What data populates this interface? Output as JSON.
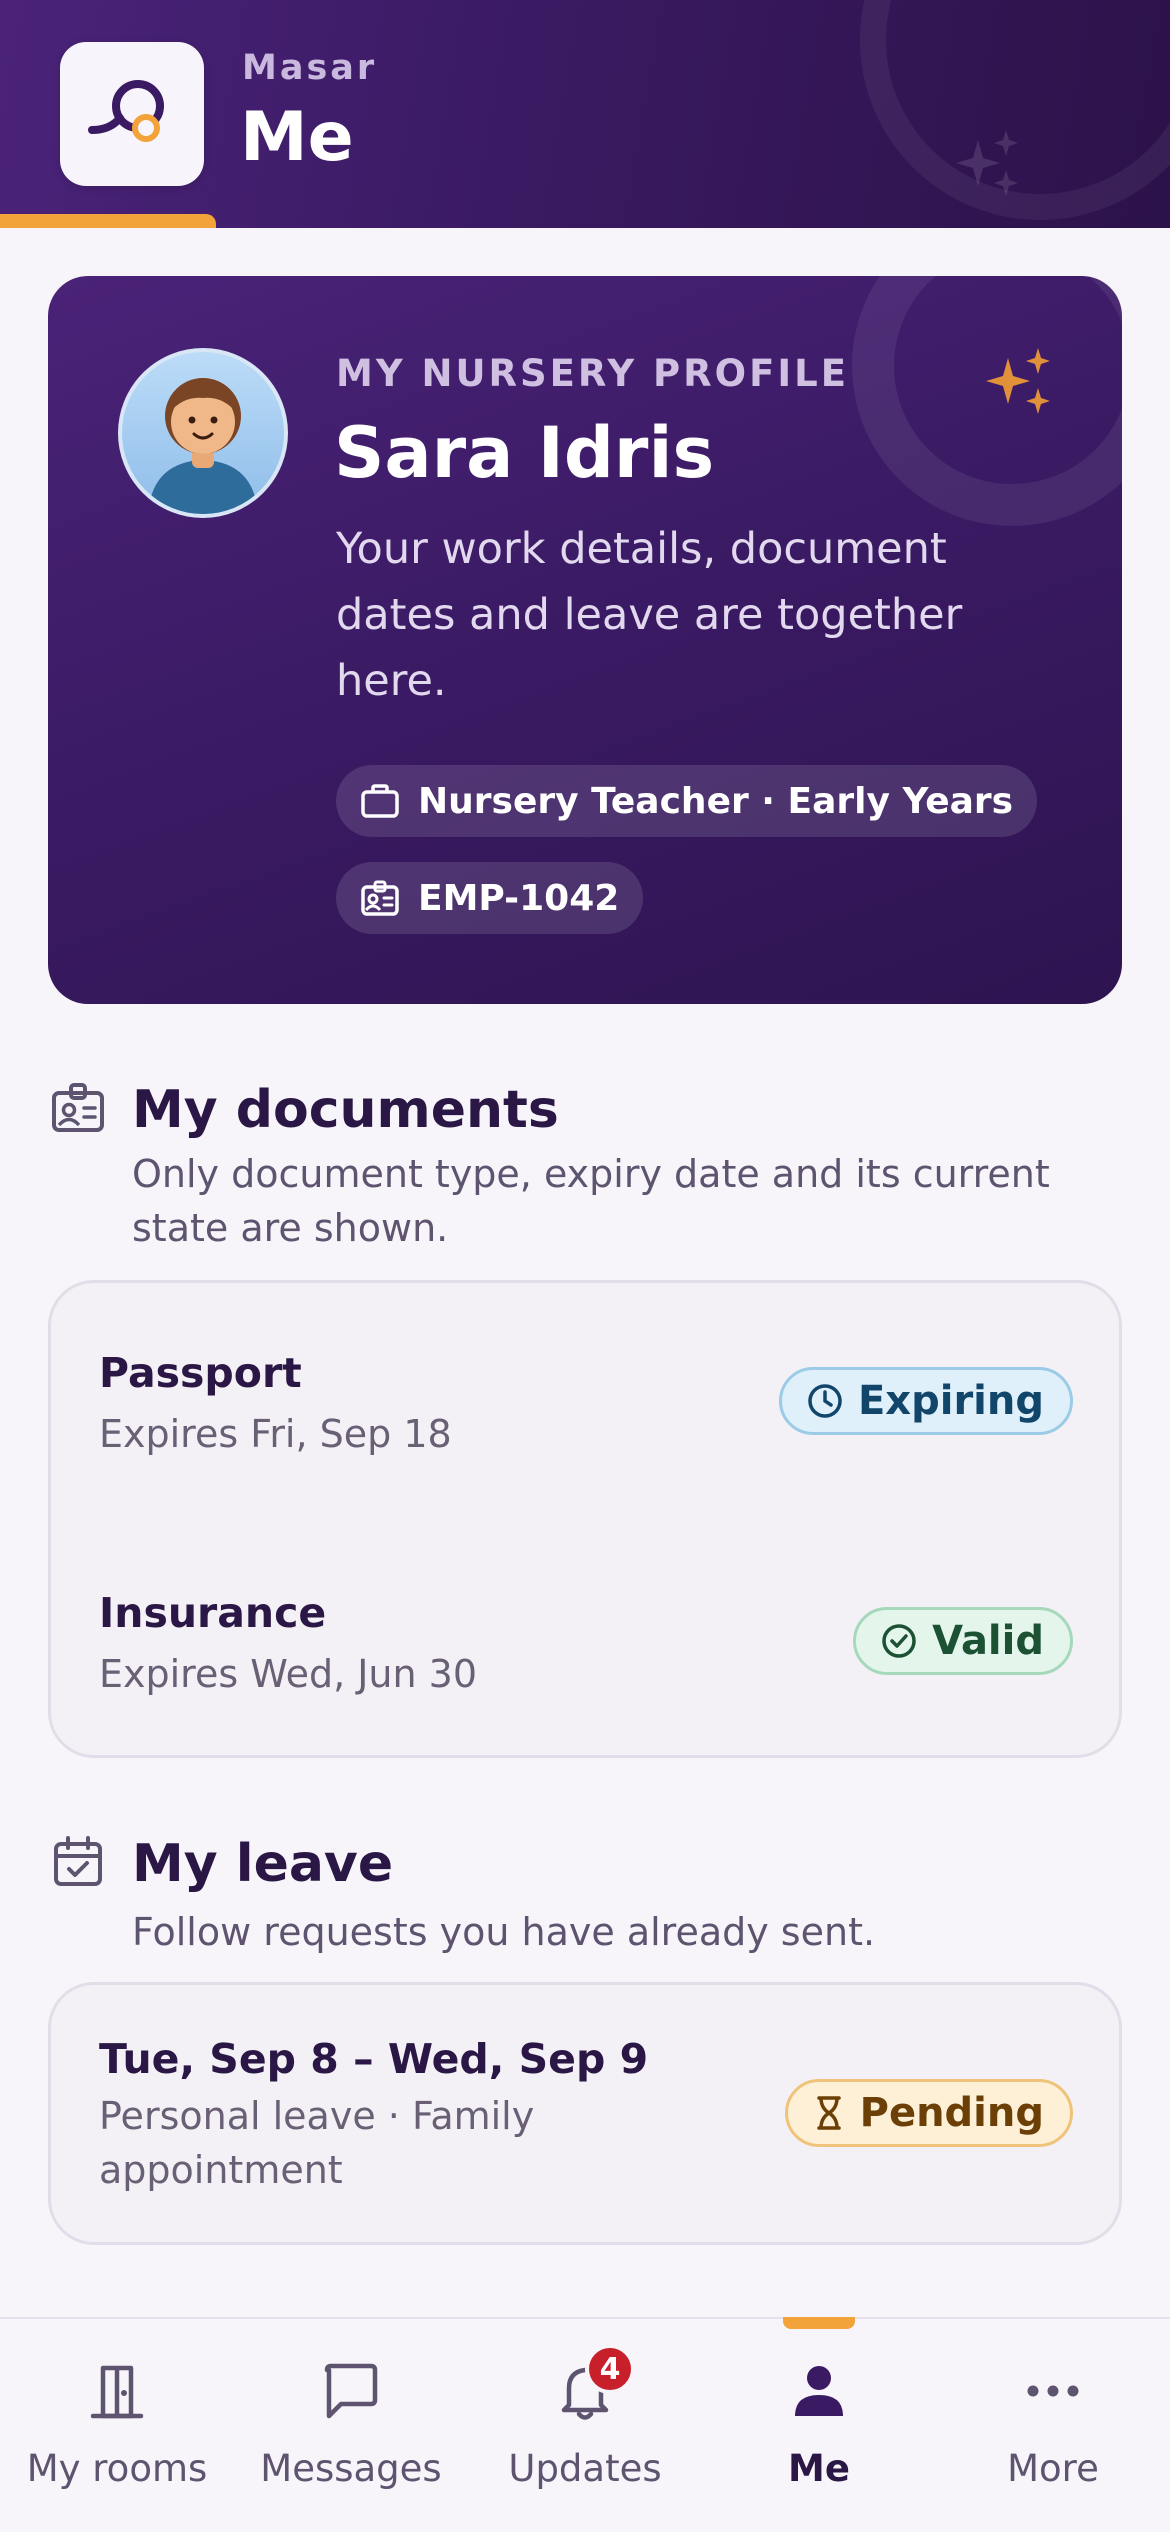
{
  "header": {
    "app_name": "Masar",
    "title": "Me"
  },
  "profile": {
    "eyebrow": "MY NURSERY PROFILE",
    "name": "Sara Idris",
    "description": "Your work details, document dates and leave are together here.",
    "role_chip": "Nursery Teacher · Early Years",
    "employee_id": "EMP-1042"
  },
  "documents": {
    "title": "My documents",
    "subtitle": "Only document type, expiry date and its current state are shown.",
    "items": [
      {
        "name": "Passport",
        "expiry": "Expires Fri, Sep 18",
        "status": "Expiring",
        "status_icon": "clock-icon"
      },
      {
        "name": "Insurance",
        "expiry": "Expires Wed, Jun 30",
        "status": "Valid",
        "status_icon": "check-circle-icon"
      }
    ]
  },
  "leave": {
    "title": "My leave",
    "subtitle": "Follow requests you have already sent.",
    "requests": [
      {
        "dates": "Tue, Sep 8 – Wed, Sep 9",
        "details": "Personal leave · Family appointment",
        "status": "Pending",
        "status_icon": "hourglass-icon"
      }
    ]
  },
  "nav": {
    "items": [
      {
        "label": "My rooms",
        "icon": "door-icon"
      },
      {
        "label": "Messages",
        "icon": "chat-bubble-icon"
      },
      {
        "label": "Updates",
        "icon": "bell-icon",
        "badge": "4"
      },
      {
        "label": "Me",
        "icon": "person-icon",
        "active": true
      },
      {
        "label": "More",
        "icon": "more-dots-icon"
      }
    ]
  },
  "colors": {
    "brand_purple": "#3a1a62",
    "accent_orange": "#f2a33a",
    "badge_red": "#c8202b"
  }
}
